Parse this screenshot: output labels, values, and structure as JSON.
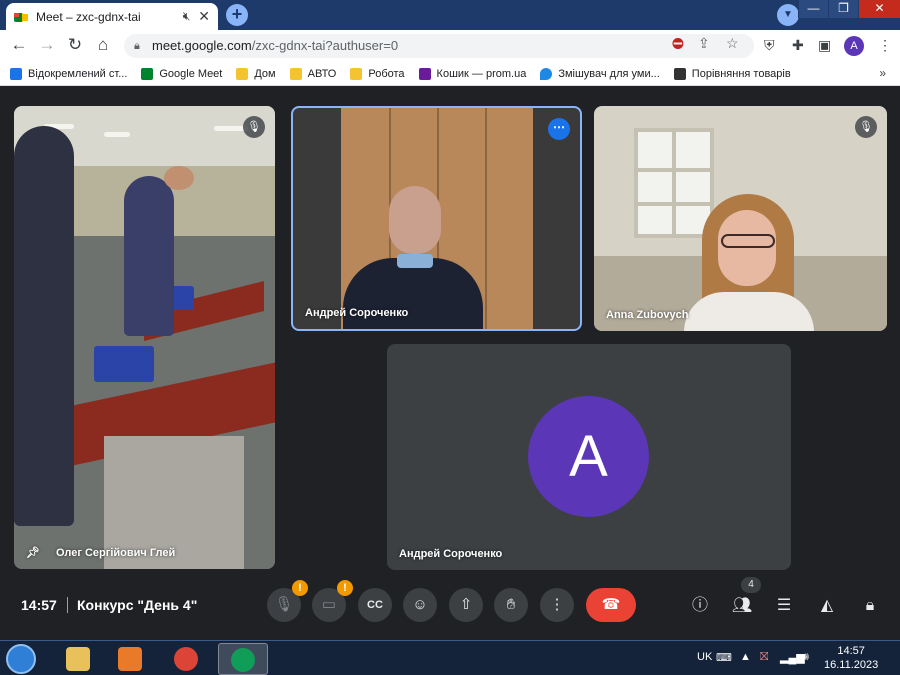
{
  "browser": {
    "tab_title": "Meet – zxc-gdnx-tai",
    "url_domain": "meet.google.com",
    "url_path": "/zxc-gdnx-tai?authuser=0",
    "profile_initial": "A"
  },
  "bookmarks": [
    {
      "label": "Відокремлений ст...",
      "icon": "calendar-icon",
      "color": "#1a73e8"
    },
    {
      "label": "Google Meet",
      "icon": "meet-icon",
      "color": "#00832d"
    },
    {
      "label": "Дом",
      "icon": "folder-icon",
      "color": "#f4c430"
    },
    {
      "label": "АВТО",
      "icon": "folder-icon",
      "color": "#f4c430"
    },
    {
      "label": "Робота",
      "icon": "folder-icon",
      "color": "#f4c430"
    },
    {
      "label": "Кошик — prom.ua",
      "icon": "prom-icon",
      "color": "#6a1b9a"
    },
    {
      "label": "Змішувач для уми...",
      "icon": "drop-icon",
      "color": "#1e88e5"
    },
    {
      "label": "Порівняння товарів",
      "icon": "compare-icon",
      "color": "#333333"
    }
  ],
  "participants": [
    {
      "name": "Олег Сергійович Глей",
      "pinned": true
    },
    {
      "name": "Андрей Сороченко",
      "speaking": true
    },
    {
      "name": "Anna Zubovych",
      "muted": true
    },
    {
      "name": "Андрей Сороченко",
      "avatar_initial": "A"
    }
  ],
  "meeting": {
    "time": "14:57",
    "name": "Конкурс \"День 4\"",
    "participant_count": "4"
  },
  "taskbar": {
    "lang": "UK",
    "time": "14:57",
    "date": "16.11.2023"
  },
  "colors": {
    "avatar": "#5b36b6",
    "end_call": "#ea4335",
    "warning": "#f29900",
    "active_border": "#8ab4f8"
  }
}
